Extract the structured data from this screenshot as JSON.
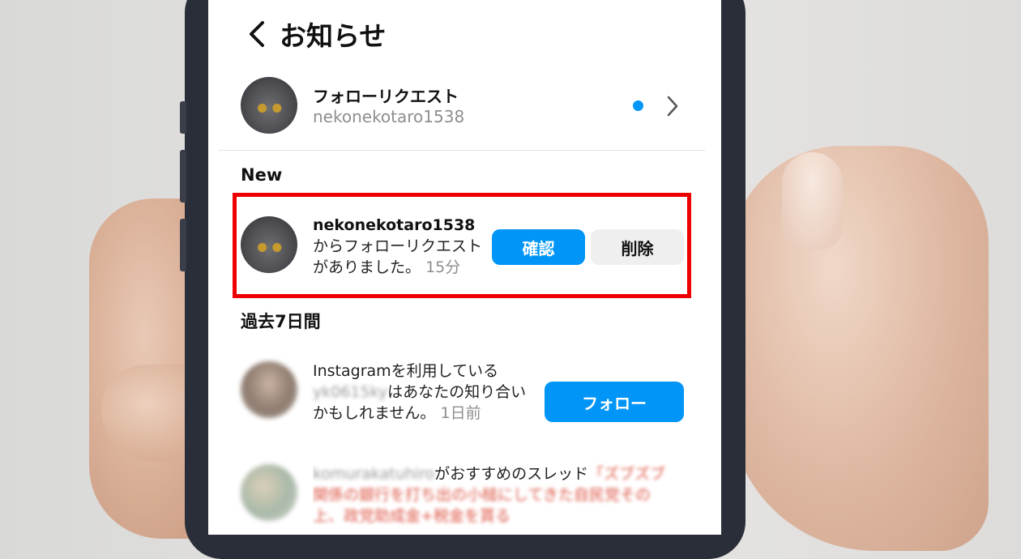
{
  "header": {
    "title": "お知らせ"
  },
  "follow_requests": {
    "title": "フォローリクエスト",
    "username": "nekonekotaro1538"
  },
  "sections": {
    "new": "New",
    "past7": "過去7日間"
  },
  "new_item": {
    "username": "nekonekotaro1538",
    "message": "からフォローリクエストがありました。",
    "time": "15分",
    "confirm_label": "確認",
    "delete_label": "削除"
  },
  "suggest_item": {
    "text_before": "Instagramを利用している",
    "blurred_username": "yk0615ky",
    "text_after": "はあなたの知り合いかもしれません。",
    "time": "1日前",
    "follow_label": "フォロー"
  },
  "thread_item": {
    "blurred_username": "komurakatuhiro",
    "text": "がおすすめのスレッド",
    "blurred_text": "「ズブズブ関係の銀行を打ち出の小槌にしてきた自民党その上、政党助成金+税金を貰る"
  },
  "colors": {
    "accent": "#0095f6",
    "highlight": "#ee0000"
  }
}
